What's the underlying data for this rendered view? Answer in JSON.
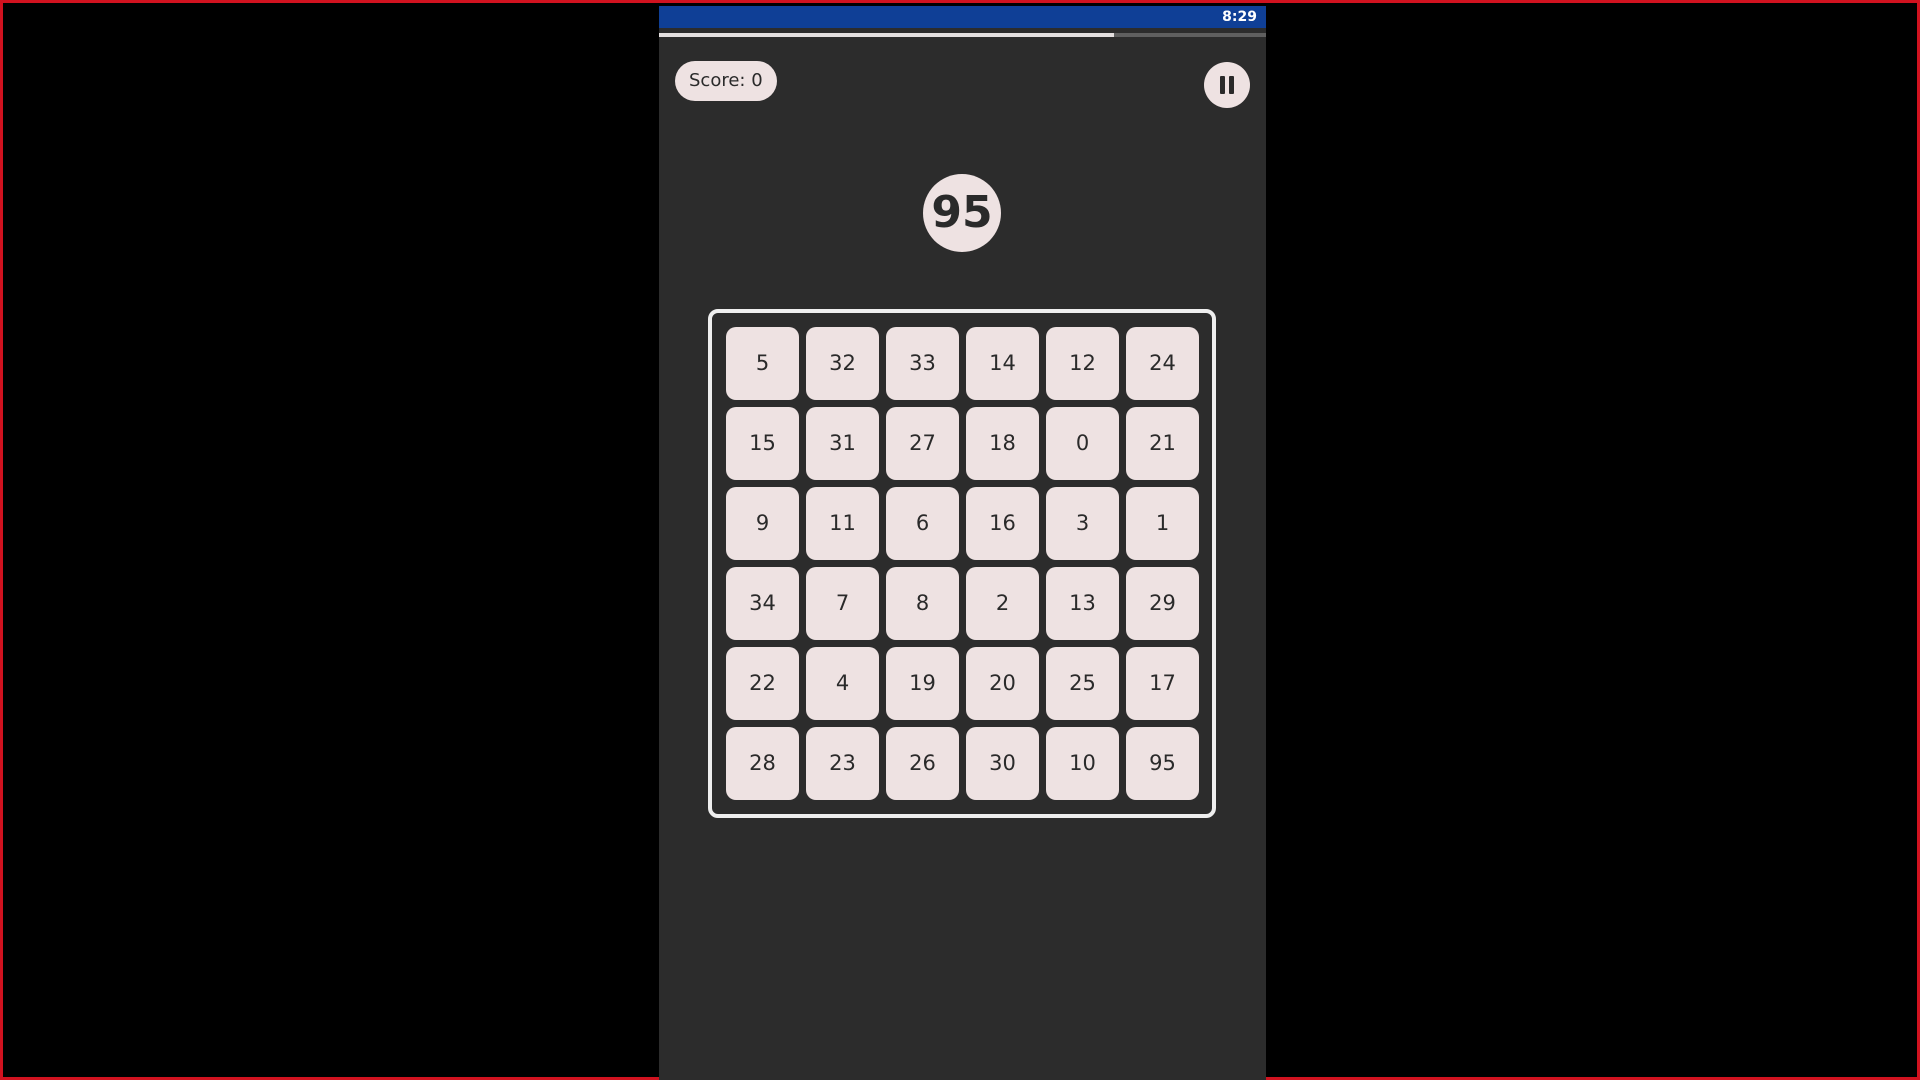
{
  "status_bar": {
    "time": "8:29"
  },
  "timer": {
    "progress_fraction": 0.75
  },
  "score": {
    "label": "Score: 0"
  },
  "pause": {
    "icon": "pause-icon"
  },
  "target": {
    "value": "95"
  },
  "board": {
    "rows": [
      [
        "5",
        "32",
        "33",
        "14",
        "12",
        "24"
      ],
      [
        "15",
        "31",
        "27",
        "18",
        "0",
        "21"
      ],
      [
        "9",
        "11",
        "6",
        "16",
        "3",
        "1"
      ],
      [
        "34",
        "7",
        "8",
        "2",
        "13",
        "29"
      ],
      [
        "22",
        "4",
        "19",
        "20",
        "25",
        "17"
      ],
      [
        "28",
        "23",
        "26",
        "30",
        "10",
        "95"
      ]
    ]
  },
  "colors": {
    "page_background": "#000000",
    "frame_border": "#d0121f",
    "app_background": "#2c2c2c",
    "status_bar": "#0f3f96",
    "tile": "#eee2e2",
    "text": "#2a2a2a"
  }
}
